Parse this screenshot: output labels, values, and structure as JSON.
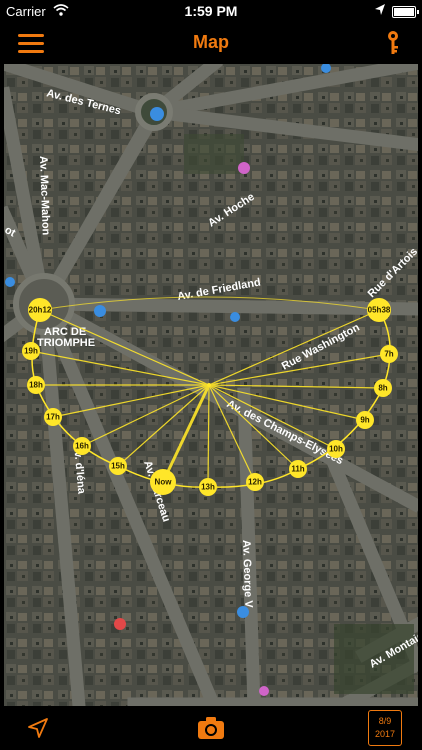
{
  "status_bar": {
    "carrier": "Carrier",
    "time": "1:59 PM"
  },
  "navbar": {
    "title": "Map"
  },
  "map": {
    "streets": {
      "ternes": "Av. des Ternes",
      "mac_mahon": "Av. Mac-Mahon",
      "hoche": "Av. Hoche",
      "friedland": "Av. de Friedland",
      "washington": "Rue Washington",
      "artois": "Rue d'Artois",
      "champs": "Av. des Champs-Elysées",
      "iena": "Av. d'Iéna",
      "marceau": "Av. Marceau",
      "george_v": "Av. George V",
      "montaigne": "Av. Montaigne",
      "carnot_fragment": "ot"
    },
    "landmark": {
      "line1": "ARC DE",
      "line2": "TRIOMPHE"
    },
    "hours": {
      "h20h12": "20h12",
      "h19": "19h",
      "h18": "18h",
      "h17": "17h",
      "h16": "16h",
      "h15": "15h",
      "now": "Now",
      "h13": "13h",
      "h12": "12h",
      "h11": "11h",
      "h10": "10h",
      "h9": "9h",
      "h8": "8h",
      "h7": "7h",
      "h05h38": "05h38"
    },
    "colors": {
      "sun_path": "#ffe629",
      "accent": "#f07a10"
    }
  },
  "bottom_bar": {
    "date_line1": "8/9",
    "date_line2": "2017"
  },
  "icons": [
    "wifi-icon",
    "location-arrow-icon",
    "battery-icon",
    "menu-icon",
    "key-icon",
    "navigation-icon",
    "camera-icon",
    "calendar-date"
  ]
}
